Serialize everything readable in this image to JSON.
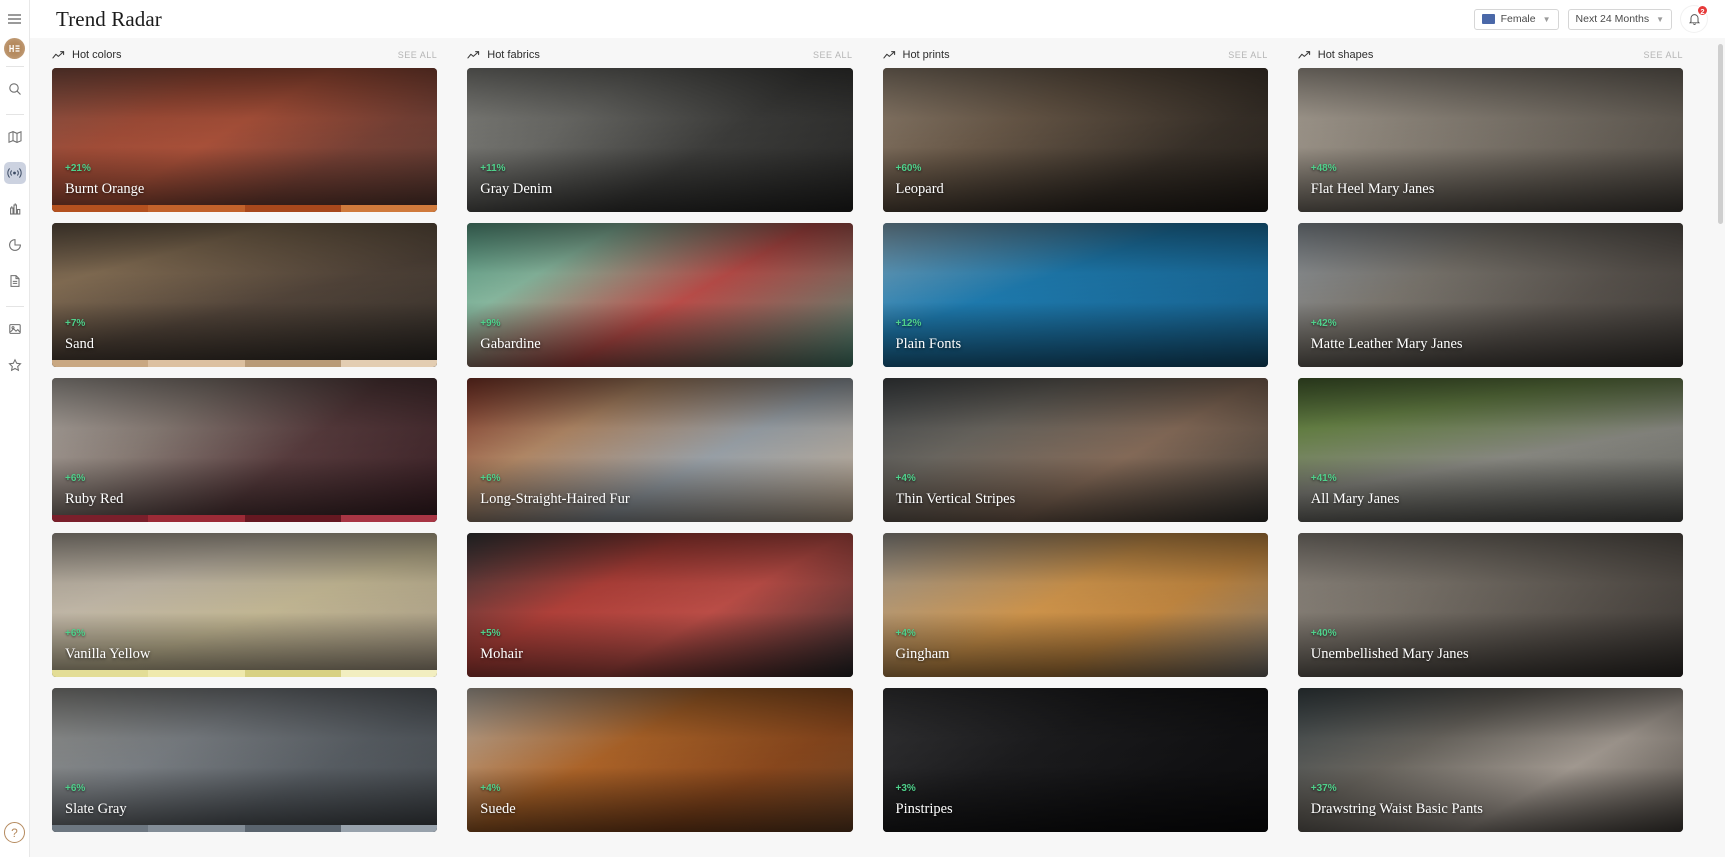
{
  "header": {
    "title": "Trend Radar",
    "menu_icon": "hamburger-icon",
    "gender_filter": {
      "label": "Female",
      "swatch_color": "#4a68a8"
    },
    "time_filter": {
      "label": "Next 24 Months"
    },
    "notifications": {
      "count": "2",
      "icon": "bell-icon"
    }
  },
  "sidebar": {
    "avatar_label": "HE",
    "items": [
      {
        "name": "search-icon",
        "label": "Search",
        "active": false
      },
      {
        "name": "map-icon",
        "label": "Map",
        "active": false
      },
      {
        "name": "radar-icon",
        "label": "Trend Radar",
        "active": true
      },
      {
        "name": "bar-chart-icon",
        "label": "Analytics",
        "active": false
      },
      {
        "name": "pie-chart-icon",
        "label": "Reports",
        "active": false
      },
      {
        "name": "document-icon",
        "label": "Documents",
        "active": false
      },
      {
        "name": "image-icon",
        "label": "Images",
        "active": false
      },
      {
        "name": "star-icon",
        "label": "Favorites",
        "active": false
      }
    ],
    "help_label": "?"
  },
  "board": {
    "see_all_label": "SEE ALL",
    "columns": [
      {
        "title": "Hot colors",
        "cards": [
          {
            "name": "Burnt Orange",
            "pct": "+21%",
            "strip": [
              "#b4511f",
              "#c2622b",
              "#a8481c",
              "#d07a3c"
            ],
            "img": "burnt-orange-photo",
            "photo_css": "linear-gradient(150deg,#8c5547 0%,#a8503a 28%,#b0543c 45%,#7c4438 70%,#5c3b33 100%)"
          },
          {
            "name": "Sand",
            "pct": "+7%",
            "strip": [
              "#c9a882",
              "#dcc0a0",
              "#b89a77",
              "#e3cdb2"
            ],
            "img": "sand-photo",
            "photo_css": "linear-gradient(165deg,#6b5b4a 0%,#8a7358 25%,#55473c 55%,#2e2a26 100%)"
          },
          {
            "name": "Ruby Red",
            "pct": "+6%",
            "strip": [
              "#7a1f2b",
              "#9b2a36",
              "#651821",
              "#a83544"
            ],
            "img": "ruby-red-photo",
            "photo_css": "linear-gradient(140deg,#b9b3ac 0%,#8e817a 30%,#5a3d3f 60%,#3a1f25 100%)"
          },
          {
            "name": "Vanilla Yellow",
            "pct": "+6%",
            "strip": [
              "#e3dd96",
              "#efe9ad",
              "#d8d183",
              "#f2eec0"
            ],
            "img": "vanilla-yellow-photo",
            "photo_css": "linear-gradient(160deg,#b9b0a4 0%,#c9bfae 30%,#cbbf9a 55%,#a79a86 100%)"
          },
          {
            "name": "Slate Gray",
            "pct": "+6%",
            "strip": [
              "#6d7781",
              "#838d97",
              "#5a646e",
              "#98a2ac"
            ],
            "img": "slate-gray-photo",
            "photo_css": "linear-gradient(150deg,#9a9a96 0%,#7e8388 35%,#5b6167 65%,#43484d 100%)"
          }
        ]
      },
      {
        "title": "Hot fabrics",
        "cards": [
          {
            "name": "Gray Denim",
            "pct": "+11%",
            "strip": [],
            "img": "gray-denim-photo",
            "photo_css": "linear-gradient(145deg,#8b8b86 0%,#6d6d69 30%,#3f3f3d 60%,#262625 100%)"
          },
          {
            "name": "Gabardine",
            "pct": "+9%",
            "strip": [],
            "img": "gabardine-photo",
            "photo_css": "linear-gradient(150deg,#5fa78e 0%,#8dbfa5 25%,#c2504c 55%,#4e8f7b 100%)"
          },
          {
            "name": "Long-Straight-Haired Fur",
            "pct": "+6%",
            "strip": [],
            "img": "long-straight-haired-fur-photo",
            "photo_css": "linear-gradient(150deg,#8a3a2c 0%,#b88d6a 30%,#9fa7ae 60%,#c9b39a 100%)"
          },
          {
            "name": "Mohair",
            "pct": "+5%",
            "strip": [],
            "img": "mohair-photo",
            "photo_css": "linear-gradient(150deg,#3b3b3d 0%,#b8433c 35%,#c4514a 60%,#2b2b2d 100%)"
          },
          {
            "name": "Suede",
            "pct": "+4%",
            "strip": [],
            "img": "suede-photo",
            "photo_css": "linear-gradient(150deg,#c6bdb1 0%,#b4682a 40%,#8e4a1e 70%,#6d4426 100%)"
          }
        ]
      },
      {
        "title": "Hot prints",
        "cards": [
          {
            "name": "Leopard",
            "pct": "+60%",
            "strip": [],
            "img": "leopard-photo",
            "photo_css": "linear-gradient(150deg,#9c8c7a 0%,#6d5c4b 35%,#3a322a 70%,#241f1a 100%)"
          },
          {
            "name": "Plain Fonts",
            "pct": "+12%",
            "strip": [],
            "img": "plain-fonts-photo",
            "photo_css": "linear-gradient(160deg,#8fb6cc 0%,#1f7fb5 40%,#1a6d9e 70%,#15587f 100%)"
          },
          {
            "name": "Thin Vertical Stripes",
            "pct": "+4%",
            "strip": [],
            "img": "thin-vertical-stripes-photo",
            "photo_css": "linear-gradient(150deg,#4a4f52 0%,#6e6a63 30%,#8a6f5c 60%,#3c3a36 100%)"
          },
          {
            "name": "Gingham",
            "pct": "+4%",
            "strip": [],
            "img": "gingham-photo",
            "photo_css": "linear-gradient(150deg,#a7a39c 0%,#d79a4e 45%,#c98c43 65%,#7e7a74 100%)"
          },
          {
            "name": "Pinstripes",
            "pct": "+3%",
            "strip": [],
            "img": "pinstripes-photo",
            "photo_css": "linear-gradient(150deg,#3a3a3c 0%,#1d1d1f 40%,#121214 70%,#0c0c0e 100%)"
          }
        ]
      },
      {
        "title": "Hot shapes",
        "cards": [
          {
            "name": "Flat Heel Mary Janes",
            "pct": "+48%",
            "strip": [],
            "img": "flat-heel-mary-janes-photo",
            "photo_css": "linear-gradient(150deg,#b9b0a4 0%,#8f877c 35%,#6a635a 70%,#4a453f 100%)"
          },
          {
            "name": "Matte Leather Mary Janes",
            "pct": "+42%",
            "strip": [],
            "img": "matte-leather-mary-janes-photo",
            "photo_css": "linear-gradient(150deg,#9aa3ab 0%,#7f7a72 35%,#5c5650 65%,#3d3935 100%)"
          },
          {
            "name": "All Mary Janes",
            "pct": "+41%",
            "strip": [],
            "img": "all-mary-janes-photo",
            "photo_css": "linear-gradient(170deg,#4e6b35 0%,#6d8a4a 25%,#8d8d86 55%,#5a5a56 100%)"
          },
          {
            "name": "Unembellished Mary Janes",
            "pct": "+40%",
            "strip": [],
            "img": "unembellished-mary-janes-photo",
            "photo_css": "linear-gradient(150deg,#9b948b 0%,#7d766d 35%,#56504a 70%,#35312e 100%)"
          },
          {
            "name": "Drawstring Waist Basic Pants",
            "pct": "+37%",
            "strip": [],
            "img": "drawstring-waist-basic-pants-photo",
            "photo_css": "linear-gradient(150deg,#3f4a4e 0%,#6e6a63 35%,#a9a097 65%,#4b4641 100%)"
          }
        ]
      }
    ]
  }
}
